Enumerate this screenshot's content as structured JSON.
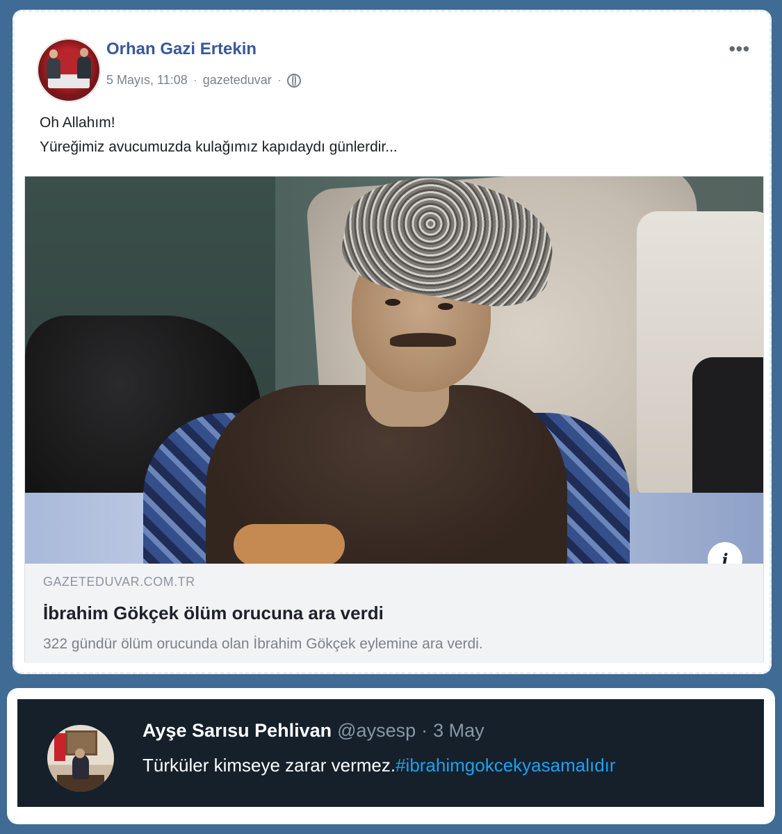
{
  "facebook_post": {
    "author": "Orhan Gazi Ertekin",
    "date": "5 Mayıs, 11:08",
    "app": "gazeteduvar",
    "meta_sep": "·",
    "more_glyph": "•••",
    "text_line1": "Oh Allahım!",
    "text_line2": "Yüreğimiz avucumuzda kulağımız kapıdaydı günlerdir...",
    "link": {
      "source": "GAZETEDUVAR.COM.TR",
      "headline": "İbrahim Gökçek ölüm orucuna ara verdi",
      "description": "322 gündür ölüm orucunda olan İbrahim Gökçek eylemine ara verdi.",
      "info_glyph": "i"
    },
    "icons": {
      "avatar": "avatar",
      "privacy": "globe-icon",
      "more": "more-icon",
      "info": "info-icon"
    }
  },
  "tweet": {
    "name": "Ayşe Sarısu Pehlivan",
    "handle": "@aysesp",
    "sep": "·",
    "date": "3 May",
    "text": "Türküler kimseye zarar vermez.",
    "hashtag": "#ibrahimgokcekyasamalıdır"
  },
  "colors": {
    "background": "#3f6b94",
    "fb_name": "#385898",
    "tw_background": "#15202b",
    "tw_link": "#1da1f2"
  }
}
